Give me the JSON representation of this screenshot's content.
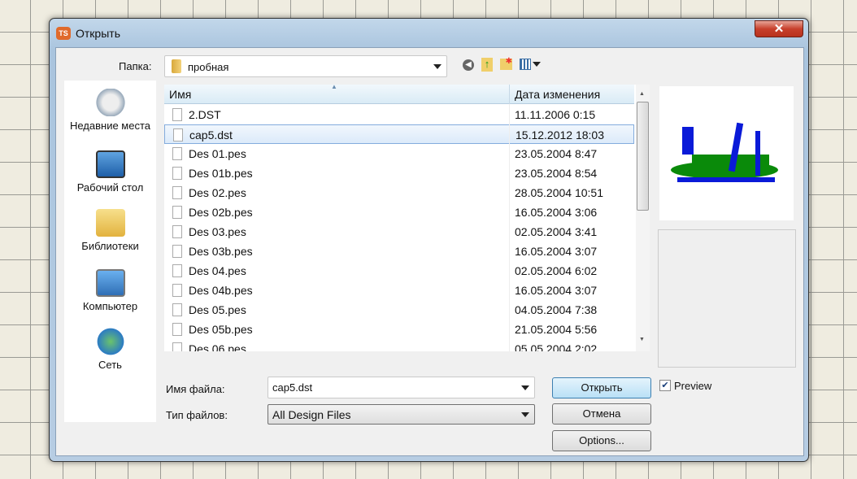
{
  "window": {
    "title": "Открыть",
    "app_icon": "TS",
    "close": "✕"
  },
  "folder": {
    "label": "Папка:",
    "value": "пробная"
  },
  "toolbar": {
    "icons": [
      "back-icon",
      "up-folder-icon",
      "new-folder-icon",
      "view-menu-icon"
    ]
  },
  "places": [
    {
      "label": "Недавние места"
    },
    {
      "label": "Рабочий стол"
    },
    {
      "label": "Библиотеки"
    },
    {
      "label": "Компьютер"
    },
    {
      "label": "Сеть"
    }
  ],
  "columns": {
    "name": "Имя",
    "date": "Дата изменения"
  },
  "files": [
    {
      "name": "2.DST",
      "date": "11.11.2006 0:15"
    },
    {
      "name": "cap5.dst",
      "date": "15.12.2012 18:03",
      "selected": true
    },
    {
      "name": "Des 01.pes",
      "date": "23.05.2004 8:47"
    },
    {
      "name": "Des 01b.pes",
      "date": "23.05.2004 8:54"
    },
    {
      "name": "Des 02.pes",
      "date": "28.05.2004 10:51"
    },
    {
      "name": "Des 02b.pes",
      "date": "16.05.2004 3:06"
    },
    {
      "name": "Des 03.pes",
      "date": "02.05.2004 3:41"
    },
    {
      "name": "Des 03b.pes",
      "date": "16.05.2004 3:07"
    },
    {
      "name": "Des 04.pes",
      "date": "02.05.2004 6:02"
    },
    {
      "name": "Des 04b.pes",
      "date": "16.05.2004 3:07"
    },
    {
      "name": "Des 05.pes",
      "date": "04.05.2004 7:38"
    },
    {
      "name": "Des 05b.pes",
      "date": "21.05.2004 5:56"
    },
    {
      "name": "Des 06.pes",
      "date": "05.05.2004 2:02"
    }
  ],
  "filename": {
    "label": "Имя файла:",
    "value": "cap5.dst"
  },
  "filetype": {
    "label": "Тип файлов:",
    "value": "All Design Files"
  },
  "buttons": {
    "open": "Открыть",
    "cancel": "Отмена",
    "options": "Options..."
  },
  "preview": {
    "label": "Preview",
    "checked": true
  }
}
